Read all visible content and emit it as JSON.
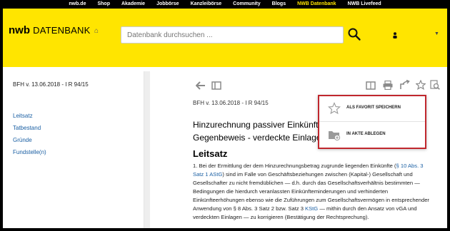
{
  "topnav": {
    "items": [
      {
        "label": "nwb.de"
      },
      {
        "label": "Shop"
      },
      {
        "label": "Akademie"
      },
      {
        "label": "Jobbörse"
      },
      {
        "label": "Kanzleibörse"
      },
      {
        "label": "Community"
      },
      {
        "label": "Blogs"
      },
      {
        "label": "NWB Datenbank"
      },
      {
        "label": "NWB Livefeed"
      }
    ],
    "active": "NWB Datenbank",
    "active_color": "#ffe500"
  },
  "header": {
    "brand": "nwb",
    "brand_sub": "DATENBANK",
    "bg_color": "#ffe500",
    "search": {
      "placeholder": "Datenbank durchsuchen ...",
      "value": ""
    },
    "icons": {
      "home": "home-icon",
      "search": "search-icon",
      "user": "user-icon",
      "menu": "caret-down-icon"
    }
  },
  "left": {
    "doc_ref": "BFH  v. 13.06.2018 - I R 94/15",
    "toc": [
      {
        "label": "Leitsatz"
      },
      {
        "label": "Tatbestand"
      },
      {
        "label": "Gründe"
      },
      {
        "label": "Fundstelle(n)"
      }
    ]
  },
  "toolbar": {
    "icons": [
      "back-icon",
      "collapse-icon",
      "compare-icon",
      "print-icon",
      "share-icon",
      "star-icon",
      "search-document-icon"
    ]
  },
  "doc": {
    "meta": "BFH   v. 13.06.2018 - I R 94/15",
    "title_line1": "Hinzurechnung passiver Einkünfte n",
    "title_line2": "Gegenbeweis - verdeckte Einlagen i",
    "section": "Leitsatz",
    "para_parts": [
      {
        "text": "1. Bei der Ermittlung der dem Hinzurechnungsbetrag zugrunde liegenden Einkünfte (",
        "link": false
      },
      {
        "text": "§ 10 Abs. 3 Satz 1 AStG",
        "link": true
      },
      {
        "text": ") sind im Falle von Geschäftsbeziehungen zwischen (Kapital-) Gesellschaft und Gesellschafter zu nicht fremdüblichen — d.h. durch das Gesellschaftsverhältnis bestimmten — Bedingungen die hierdurch veranlassten Einkünfteminderungen und verhinderten Einkünfteerhöhungen ebenso wie die Zuführungen zum Gesellschaftsvermögen in entsprechender Anwendung von § 8 Abs. 3 Satz 2 bzw. Satz 3 ",
        "link": false
      },
      {
        "text": "KStG",
        "link": true
      },
      {
        "text": " — mithin durch den Ansatz von vGA und verdeckten Einlagen — zu korrigieren (Bestätigung der Rechtsprechung).",
        "link": false
      }
    ]
  },
  "popup": {
    "items": [
      {
        "label": "ALS FAVORIT SPEICHERN",
        "icon": "star-outline-icon"
      },
      {
        "label": "IN AKTE ABLEGEN",
        "icon": "folder-add-icon"
      }
    ],
    "border_color": "#c0272d"
  }
}
